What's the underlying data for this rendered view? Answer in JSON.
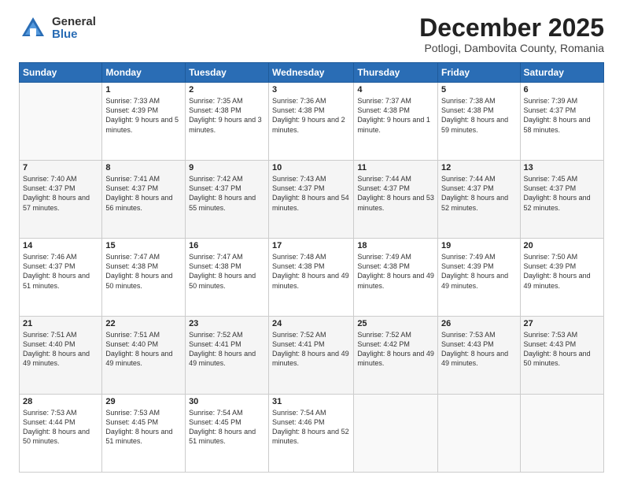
{
  "logo": {
    "general": "General",
    "blue": "Blue"
  },
  "header": {
    "month": "December 2025",
    "location": "Potlogi, Dambovita County, Romania"
  },
  "weekdays": [
    "Sunday",
    "Monday",
    "Tuesday",
    "Wednesday",
    "Thursday",
    "Friday",
    "Saturday"
  ],
  "weeks": [
    [
      {
        "day": "",
        "content": ""
      },
      {
        "day": "1",
        "content": "Sunrise: 7:33 AM\nSunset: 4:39 PM\nDaylight: 9 hours\nand 5 minutes."
      },
      {
        "day": "2",
        "content": "Sunrise: 7:35 AM\nSunset: 4:38 PM\nDaylight: 9 hours\nand 3 minutes."
      },
      {
        "day": "3",
        "content": "Sunrise: 7:36 AM\nSunset: 4:38 PM\nDaylight: 9 hours\nand 2 minutes."
      },
      {
        "day": "4",
        "content": "Sunrise: 7:37 AM\nSunset: 4:38 PM\nDaylight: 9 hours\nand 1 minute."
      },
      {
        "day": "5",
        "content": "Sunrise: 7:38 AM\nSunset: 4:38 PM\nDaylight: 8 hours\nand 59 minutes."
      },
      {
        "day": "6",
        "content": "Sunrise: 7:39 AM\nSunset: 4:37 PM\nDaylight: 8 hours\nand 58 minutes."
      }
    ],
    [
      {
        "day": "7",
        "content": "Sunrise: 7:40 AM\nSunset: 4:37 PM\nDaylight: 8 hours\nand 57 minutes."
      },
      {
        "day": "8",
        "content": "Sunrise: 7:41 AM\nSunset: 4:37 PM\nDaylight: 8 hours\nand 56 minutes."
      },
      {
        "day": "9",
        "content": "Sunrise: 7:42 AM\nSunset: 4:37 PM\nDaylight: 8 hours\nand 55 minutes."
      },
      {
        "day": "10",
        "content": "Sunrise: 7:43 AM\nSunset: 4:37 PM\nDaylight: 8 hours\nand 54 minutes."
      },
      {
        "day": "11",
        "content": "Sunrise: 7:44 AM\nSunset: 4:37 PM\nDaylight: 8 hours\nand 53 minutes."
      },
      {
        "day": "12",
        "content": "Sunrise: 7:44 AM\nSunset: 4:37 PM\nDaylight: 8 hours\nand 52 minutes."
      },
      {
        "day": "13",
        "content": "Sunrise: 7:45 AM\nSunset: 4:37 PM\nDaylight: 8 hours\nand 52 minutes."
      }
    ],
    [
      {
        "day": "14",
        "content": "Sunrise: 7:46 AM\nSunset: 4:37 PM\nDaylight: 8 hours\nand 51 minutes."
      },
      {
        "day": "15",
        "content": "Sunrise: 7:47 AM\nSunset: 4:38 PM\nDaylight: 8 hours\nand 50 minutes."
      },
      {
        "day": "16",
        "content": "Sunrise: 7:47 AM\nSunset: 4:38 PM\nDaylight: 8 hours\nand 50 minutes."
      },
      {
        "day": "17",
        "content": "Sunrise: 7:48 AM\nSunset: 4:38 PM\nDaylight: 8 hours\nand 49 minutes."
      },
      {
        "day": "18",
        "content": "Sunrise: 7:49 AM\nSunset: 4:38 PM\nDaylight: 8 hours\nand 49 minutes."
      },
      {
        "day": "19",
        "content": "Sunrise: 7:49 AM\nSunset: 4:39 PM\nDaylight: 8 hours\nand 49 minutes."
      },
      {
        "day": "20",
        "content": "Sunrise: 7:50 AM\nSunset: 4:39 PM\nDaylight: 8 hours\nand 49 minutes."
      }
    ],
    [
      {
        "day": "21",
        "content": "Sunrise: 7:51 AM\nSunset: 4:40 PM\nDaylight: 8 hours\nand 49 minutes."
      },
      {
        "day": "22",
        "content": "Sunrise: 7:51 AM\nSunset: 4:40 PM\nDaylight: 8 hours\nand 49 minutes."
      },
      {
        "day": "23",
        "content": "Sunrise: 7:52 AM\nSunset: 4:41 PM\nDaylight: 8 hours\nand 49 minutes."
      },
      {
        "day": "24",
        "content": "Sunrise: 7:52 AM\nSunset: 4:41 PM\nDaylight: 8 hours\nand 49 minutes."
      },
      {
        "day": "25",
        "content": "Sunrise: 7:52 AM\nSunset: 4:42 PM\nDaylight: 8 hours\nand 49 minutes."
      },
      {
        "day": "26",
        "content": "Sunrise: 7:53 AM\nSunset: 4:43 PM\nDaylight: 8 hours\nand 49 minutes."
      },
      {
        "day": "27",
        "content": "Sunrise: 7:53 AM\nSunset: 4:43 PM\nDaylight: 8 hours\nand 50 minutes."
      }
    ],
    [
      {
        "day": "28",
        "content": "Sunrise: 7:53 AM\nSunset: 4:44 PM\nDaylight: 8 hours\nand 50 minutes."
      },
      {
        "day": "29",
        "content": "Sunrise: 7:53 AM\nSunset: 4:45 PM\nDaylight: 8 hours\nand 51 minutes."
      },
      {
        "day": "30",
        "content": "Sunrise: 7:54 AM\nSunset: 4:45 PM\nDaylight: 8 hours\nand 51 minutes."
      },
      {
        "day": "31",
        "content": "Sunrise: 7:54 AM\nSunset: 4:46 PM\nDaylight: 8 hours\nand 52 minutes."
      },
      {
        "day": "",
        "content": ""
      },
      {
        "day": "",
        "content": ""
      },
      {
        "day": "",
        "content": ""
      }
    ]
  ]
}
